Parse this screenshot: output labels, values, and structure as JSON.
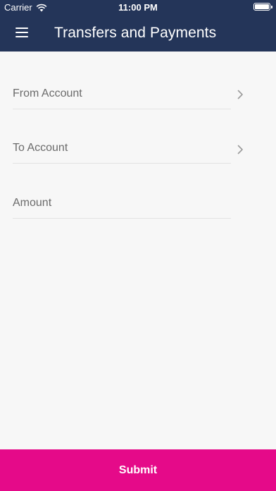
{
  "status_bar": {
    "carrier": "Carrier",
    "time": "11:00 PM",
    "wifi_icon": "wifi-icon",
    "battery_icon": "battery-icon",
    "battery_level": 1.0
  },
  "nav_bar": {
    "menu_icon": "menu-icon",
    "title": "Transfers and Payments"
  },
  "form": {
    "from_account": {
      "label": "From Account",
      "icon": "chevron-right-icon"
    },
    "to_account": {
      "label": "To Account",
      "icon": "chevron-right-icon"
    },
    "amount": {
      "label": "Amount"
    }
  },
  "submit": {
    "label": "Submit"
  },
  "colors": {
    "header_background": "#243559",
    "accent": "#e50a89",
    "page_background": "#f7f7f7",
    "label_text": "#6b6b6b",
    "divider": "#e3e3e3",
    "chevron": "#9b9b9b"
  }
}
